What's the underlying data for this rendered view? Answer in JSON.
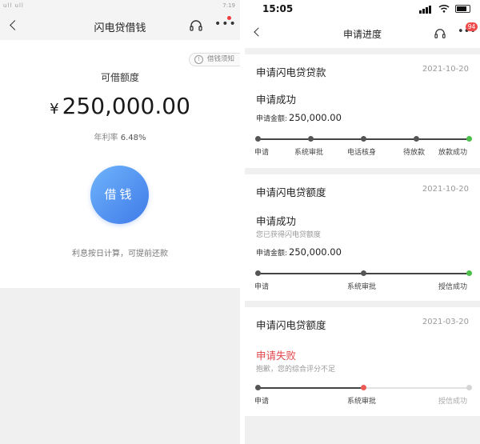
{
  "left_screen": {
    "status_bar": {
      "signal_text": "ull ull",
      "speed": "116 K/s",
      "time": "7:19"
    },
    "nav": {
      "title": "闪电贷借钱"
    },
    "notice_label": "借钱须知",
    "quota_label": "可借额度",
    "currency_symbol": "¥",
    "amount": "250,000.00",
    "rate_label": "年利率",
    "rate_value": "6.48%",
    "borrow_button": "借钱",
    "interest_note": "利息按日计算，可提前还款"
  },
  "right_screen": {
    "status_bar": {
      "time": "15:05"
    },
    "nav": {
      "title": "申请进度",
      "badge_count": "94"
    },
    "cards": [
      {
        "title": "申请闪电贷贷款",
        "date": "2021-10-20",
        "status": "申请成功",
        "amount_label": "申请金额:",
        "amount": "250,000.00",
        "steps": [
          "申请",
          "系统审批",
          "电话核身",
          "待放款",
          "放款成功"
        ],
        "progress_fraction": 1.0
      },
      {
        "title": "申请闪电贷额度",
        "date": "2021-10-20",
        "status": "申请成功",
        "sub_text": "您已获得闪电贷额度",
        "amount_label": "申请金额:",
        "amount": "250,000.00",
        "steps": [
          "申请",
          "系统审批",
          "授信成功"
        ],
        "progress_fraction": 1.0
      },
      {
        "title": "申请闪电贷额度",
        "date": "2021-03-20",
        "status": "申请失败",
        "sub_text": "抱歉，您的综合评分不足",
        "steps": [
          "申请",
          "系统审批",
          "授信成功"
        ],
        "progress_fraction": 0.5
      }
    ]
  },
  "colors": {
    "accent_blue_start": "#6fb4fb",
    "accent_blue_end": "#3f7ae8",
    "success_green": "#4bbf49",
    "fail_red": "#e0454a",
    "badge_red": "#ee4b4b"
  }
}
